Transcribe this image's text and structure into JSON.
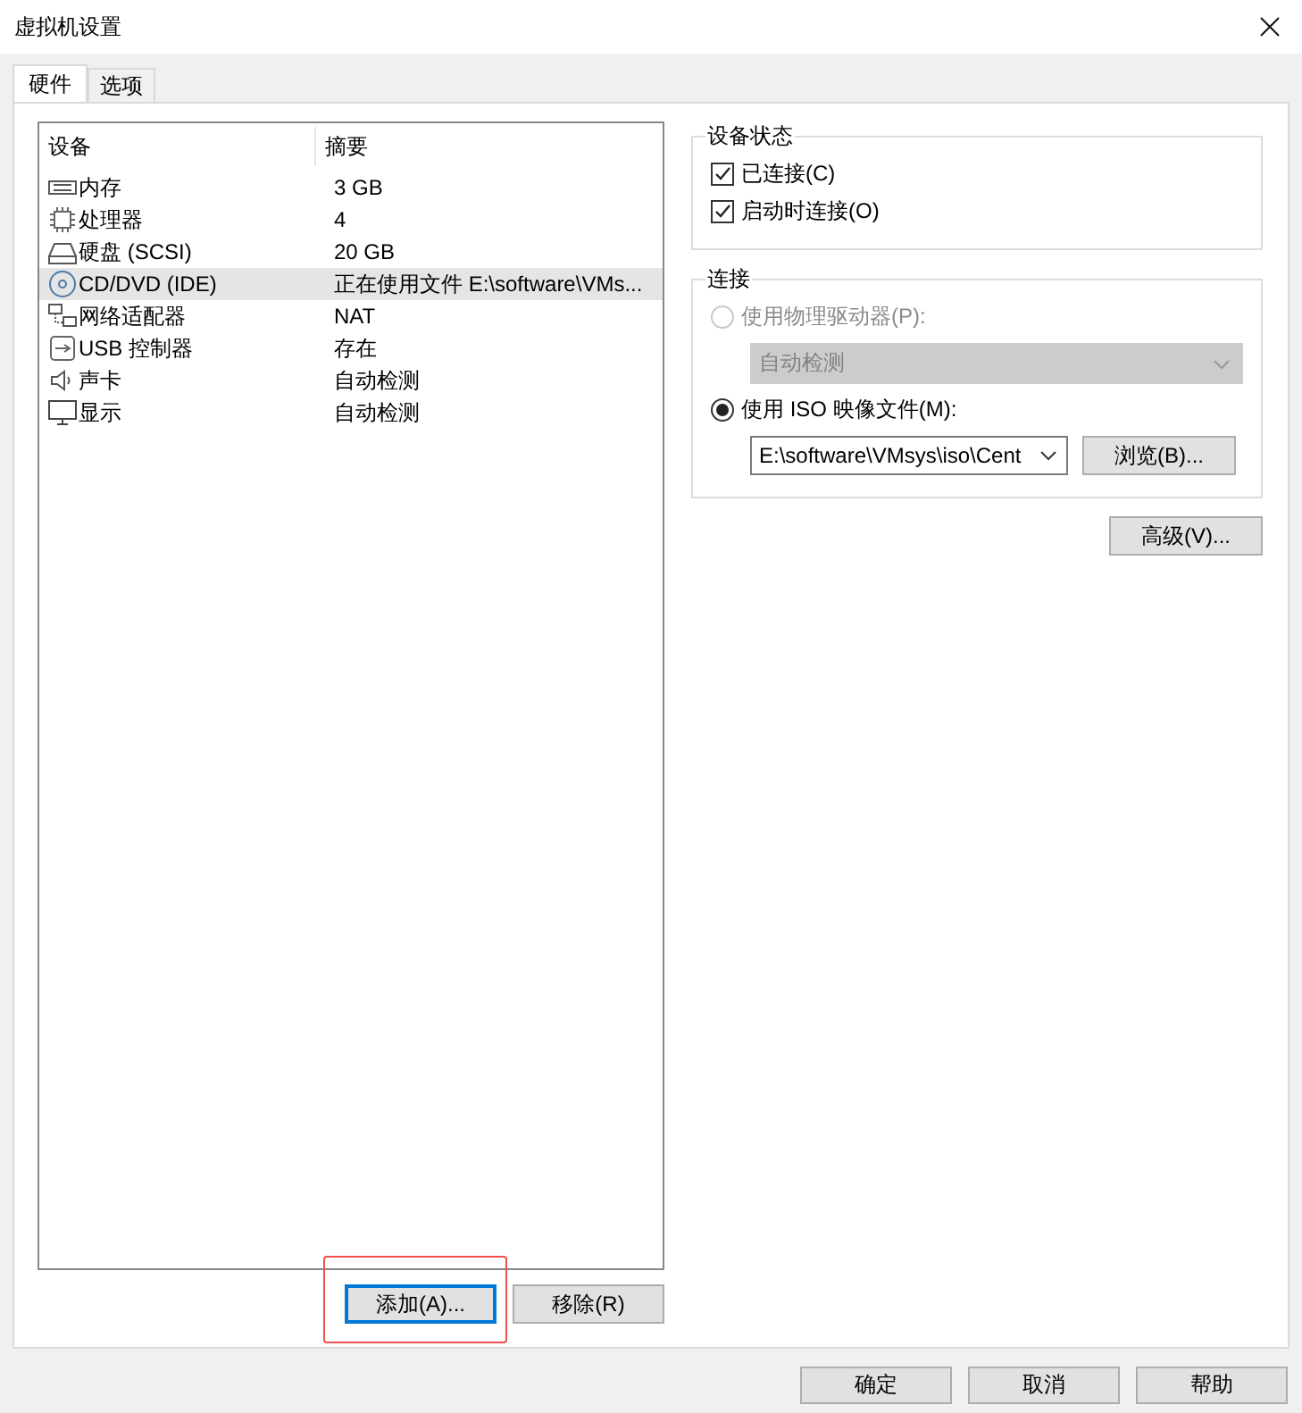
{
  "window": {
    "title": "虚拟机设置"
  },
  "tabs": [
    {
      "label": "硬件",
      "selected": true
    },
    {
      "label": "选项",
      "selected": false
    }
  ],
  "device_list": {
    "columns": [
      "设备",
      "摘要"
    ],
    "rows": [
      {
        "kind": "memory",
        "device": "内存",
        "summary": "3 GB",
        "selected": false
      },
      {
        "kind": "cpu",
        "device": "处理器",
        "summary": "4",
        "selected": false
      },
      {
        "kind": "disk",
        "device": "硬盘 (SCSI)",
        "summary": "20 GB",
        "selected": false
      },
      {
        "kind": "cdrom",
        "device": "CD/DVD (IDE)",
        "summary": "正在使用文件 E:\\software\\VMs...",
        "selected": true
      },
      {
        "kind": "network",
        "device": "网络适配器",
        "summary": "NAT",
        "selected": false
      },
      {
        "kind": "usb",
        "device": "USB 控制器",
        "summary": "存在",
        "selected": false
      },
      {
        "kind": "sound",
        "device": "声卡",
        "summary": "自动检测",
        "selected": false
      },
      {
        "kind": "display",
        "device": "显示",
        "summary": "自动检测",
        "selected": false
      }
    ]
  },
  "list_buttons": [
    {
      "label": "添加(A)...",
      "focused": true,
      "highlighted": true
    },
    {
      "label": "移除(R)",
      "focused": false,
      "highlighted": false
    }
  ],
  "device_status": {
    "title": "设备状态",
    "checkboxes": [
      {
        "label": "已连接(C)",
        "checked": true
      },
      {
        "label": "启动时连接(O)",
        "checked": true
      }
    ]
  },
  "connection": {
    "title": "连接",
    "physical_drive": {
      "label": "使用物理驱动器(P):",
      "selected": false,
      "disabled": true,
      "dropdown": "自动检测"
    },
    "iso_image": {
      "label": "使用 ISO 映像文件(M):",
      "selected": true,
      "disabled": false,
      "path": "E:\\software\\VMsys\\iso\\Cent",
      "browse": "浏览(B)..."
    }
  },
  "advanced_button": "高级(V)...",
  "footer_buttons": [
    "确定",
    "取消",
    "帮助"
  ]
}
